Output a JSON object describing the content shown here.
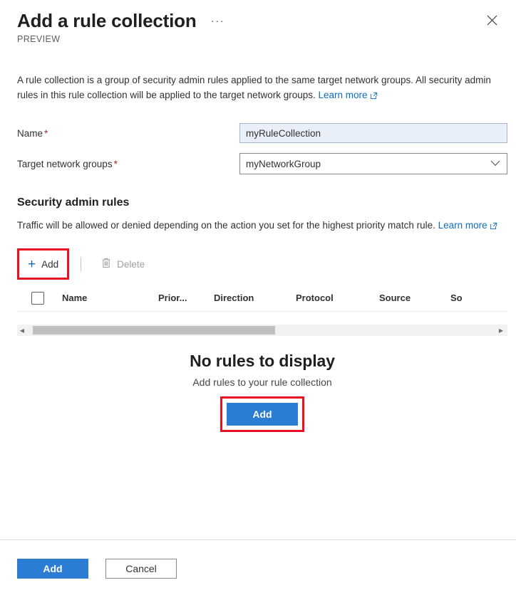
{
  "header": {
    "title": "Add a rule collection",
    "preview_label": "PREVIEW",
    "ellipsis_label": "···",
    "close_label": "Close"
  },
  "intro": {
    "text": "A rule collection is a group of security admin rules applied to the same target network groups. All security admin rules in this rule collection will be applied to the target network groups. ",
    "link_label": "Learn more"
  },
  "form": {
    "name": {
      "label": "Name",
      "required_marker": "*",
      "value": "myRuleCollection",
      "placeholder": ""
    },
    "target_network_groups": {
      "label": "Target network groups",
      "required_marker": "*",
      "value": "myNetworkGroup",
      "options": [
        "myNetworkGroup"
      ]
    }
  },
  "section": {
    "heading": "Security admin rules",
    "description_before": "Traffic will be allowed or denied depending on the action you set for the highest priority match rule. ",
    "link_label": "Learn more"
  },
  "toolbar": {
    "add_label": "Add",
    "add_icon": "plus-icon",
    "delete_label": "Delete",
    "delete_icon": "trash-icon",
    "delete_disabled": true
  },
  "grid": {
    "columns": [
      {
        "label": "Name"
      },
      {
        "label": "Prior..."
      },
      {
        "label": "Direction"
      },
      {
        "label": "Protocol"
      },
      {
        "label": "Source"
      },
      {
        "label": "So"
      }
    ],
    "rows": [],
    "select_all_checked": false
  },
  "empty_state": {
    "title": "No rules to display",
    "subtitle": "Add rules to your rule collection",
    "action_label": "Add"
  },
  "footer": {
    "primary_label": "Add",
    "secondary_label": "Cancel"
  },
  "colors": {
    "accent": "#2b7cd3",
    "link": "#0f6cbd",
    "required": "#a4262c",
    "highlight_outline": "#e81123",
    "focused_input_bg": "#e9eff9"
  }
}
